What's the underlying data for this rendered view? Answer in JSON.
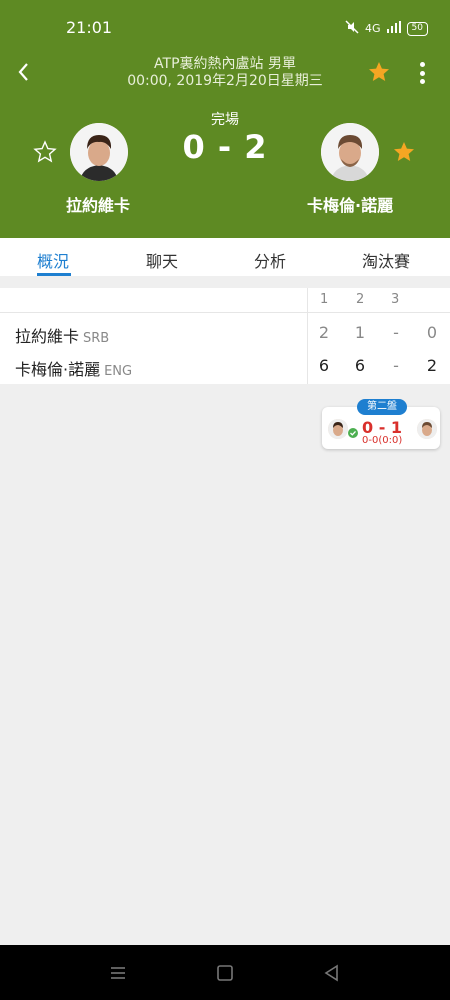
{
  "status_bar": {
    "time": "21:01",
    "battery": "50",
    "network": "4G"
  },
  "header": {
    "title": "ATP裏約熱內盧站 男單",
    "date": "00:00, 2019年2月20日星期三",
    "match_status": "完場",
    "score": "0 - 2",
    "left_player": {
      "name": "拉約維卡",
      "favorited": false
    },
    "right_player": {
      "name": "卡梅倫·諾麗",
      "favorited": true
    }
  },
  "tabs": [
    {
      "label": "概況",
      "active": true
    },
    {
      "label": "聊天",
      "active": false
    },
    {
      "label": "分析",
      "active": false
    },
    {
      "label": "淘汰賽",
      "active": false
    }
  ],
  "score_table": {
    "set_headers": [
      "1",
      "2",
      "3"
    ],
    "rows": [
      {
        "name": "拉約維卡",
        "country": "SRB",
        "sets": [
          "2",
          "1",
          "-"
        ],
        "total": "0"
      },
      {
        "name": "卡梅倫·諾麗",
        "country": "ENG",
        "sets": [
          "6",
          "6",
          "-"
        ],
        "total": "2"
      }
    ]
  },
  "set_card": {
    "badge": "第二盤",
    "score": "0 - 1",
    "sub": "0-0(0:0)"
  },
  "colors": {
    "header_bg": "#5e8a23",
    "accent_blue": "#1e7fd0",
    "star_gold": "#f5a623",
    "score_red": "#d9302c"
  }
}
